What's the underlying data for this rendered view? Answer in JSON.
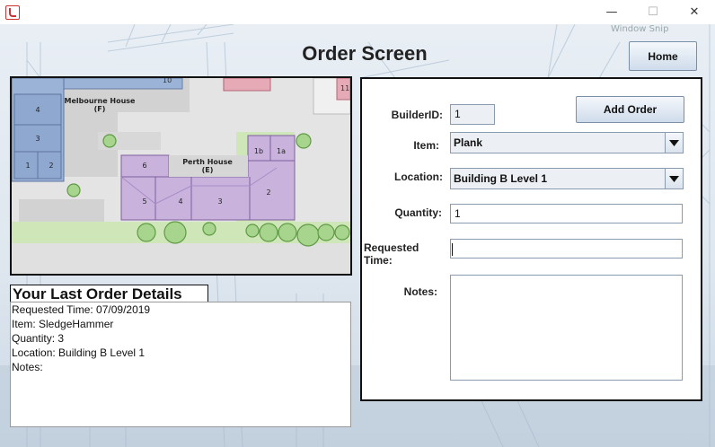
{
  "window": {
    "minimize_glyph": "—",
    "maximize_glyph": "☐",
    "close_glyph": "✕",
    "snip_label": "Window Snip"
  },
  "header": {
    "title": "Order Screen",
    "home_label": "Home"
  },
  "map": {
    "melbourne_house": "Melbourne House",
    "melbourne_code": "(F)",
    "perth_house": "Perth House",
    "perth_code": "(E)",
    "units_left": [
      "4",
      "3",
      "1",
      "2"
    ],
    "units_main": [
      "6",
      "5",
      "4",
      "3",
      "2",
      "1b",
      "1a"
    ],
    "top_labels": [
      "10",
      "11"
    ]
  },
  "last_order": {
    "heading": "Your Last Order Details",
    "requested_time": "Requested Time: 07/09/2019",
    "item": "Item: SledgeHammer",
    "quantity": "Quantity: 3",
    "location": "Location: Building B Level 1",
    "notes": "Notes:"
  },
  "form": {
    "builder_id_label": "BuilderID:",
    "builder_id_value": "1",
    "add_order_label": "Add Order",
    "item_label": "Item:",
    "item_value": "Plank",
    "location_label": "Location:",
    "location_value": "Building B Level 1",
    "quantity_label": "Quantity:",
    "quantity_value": "1",
    "requested_time_label": "Requested Time:",
    "requested_time_value": "",
    "notes_label": "Notes:",
    "notes_value": ""
  },
  "colors": {
    "map_purple": "#c9b3dd",
    "map_blue": "#9bb3d6",
    "map_green": "#cfe6b8",
    "tree_green": "#a8d58e",
    "accent": "#7a8fa6"
  }
}
